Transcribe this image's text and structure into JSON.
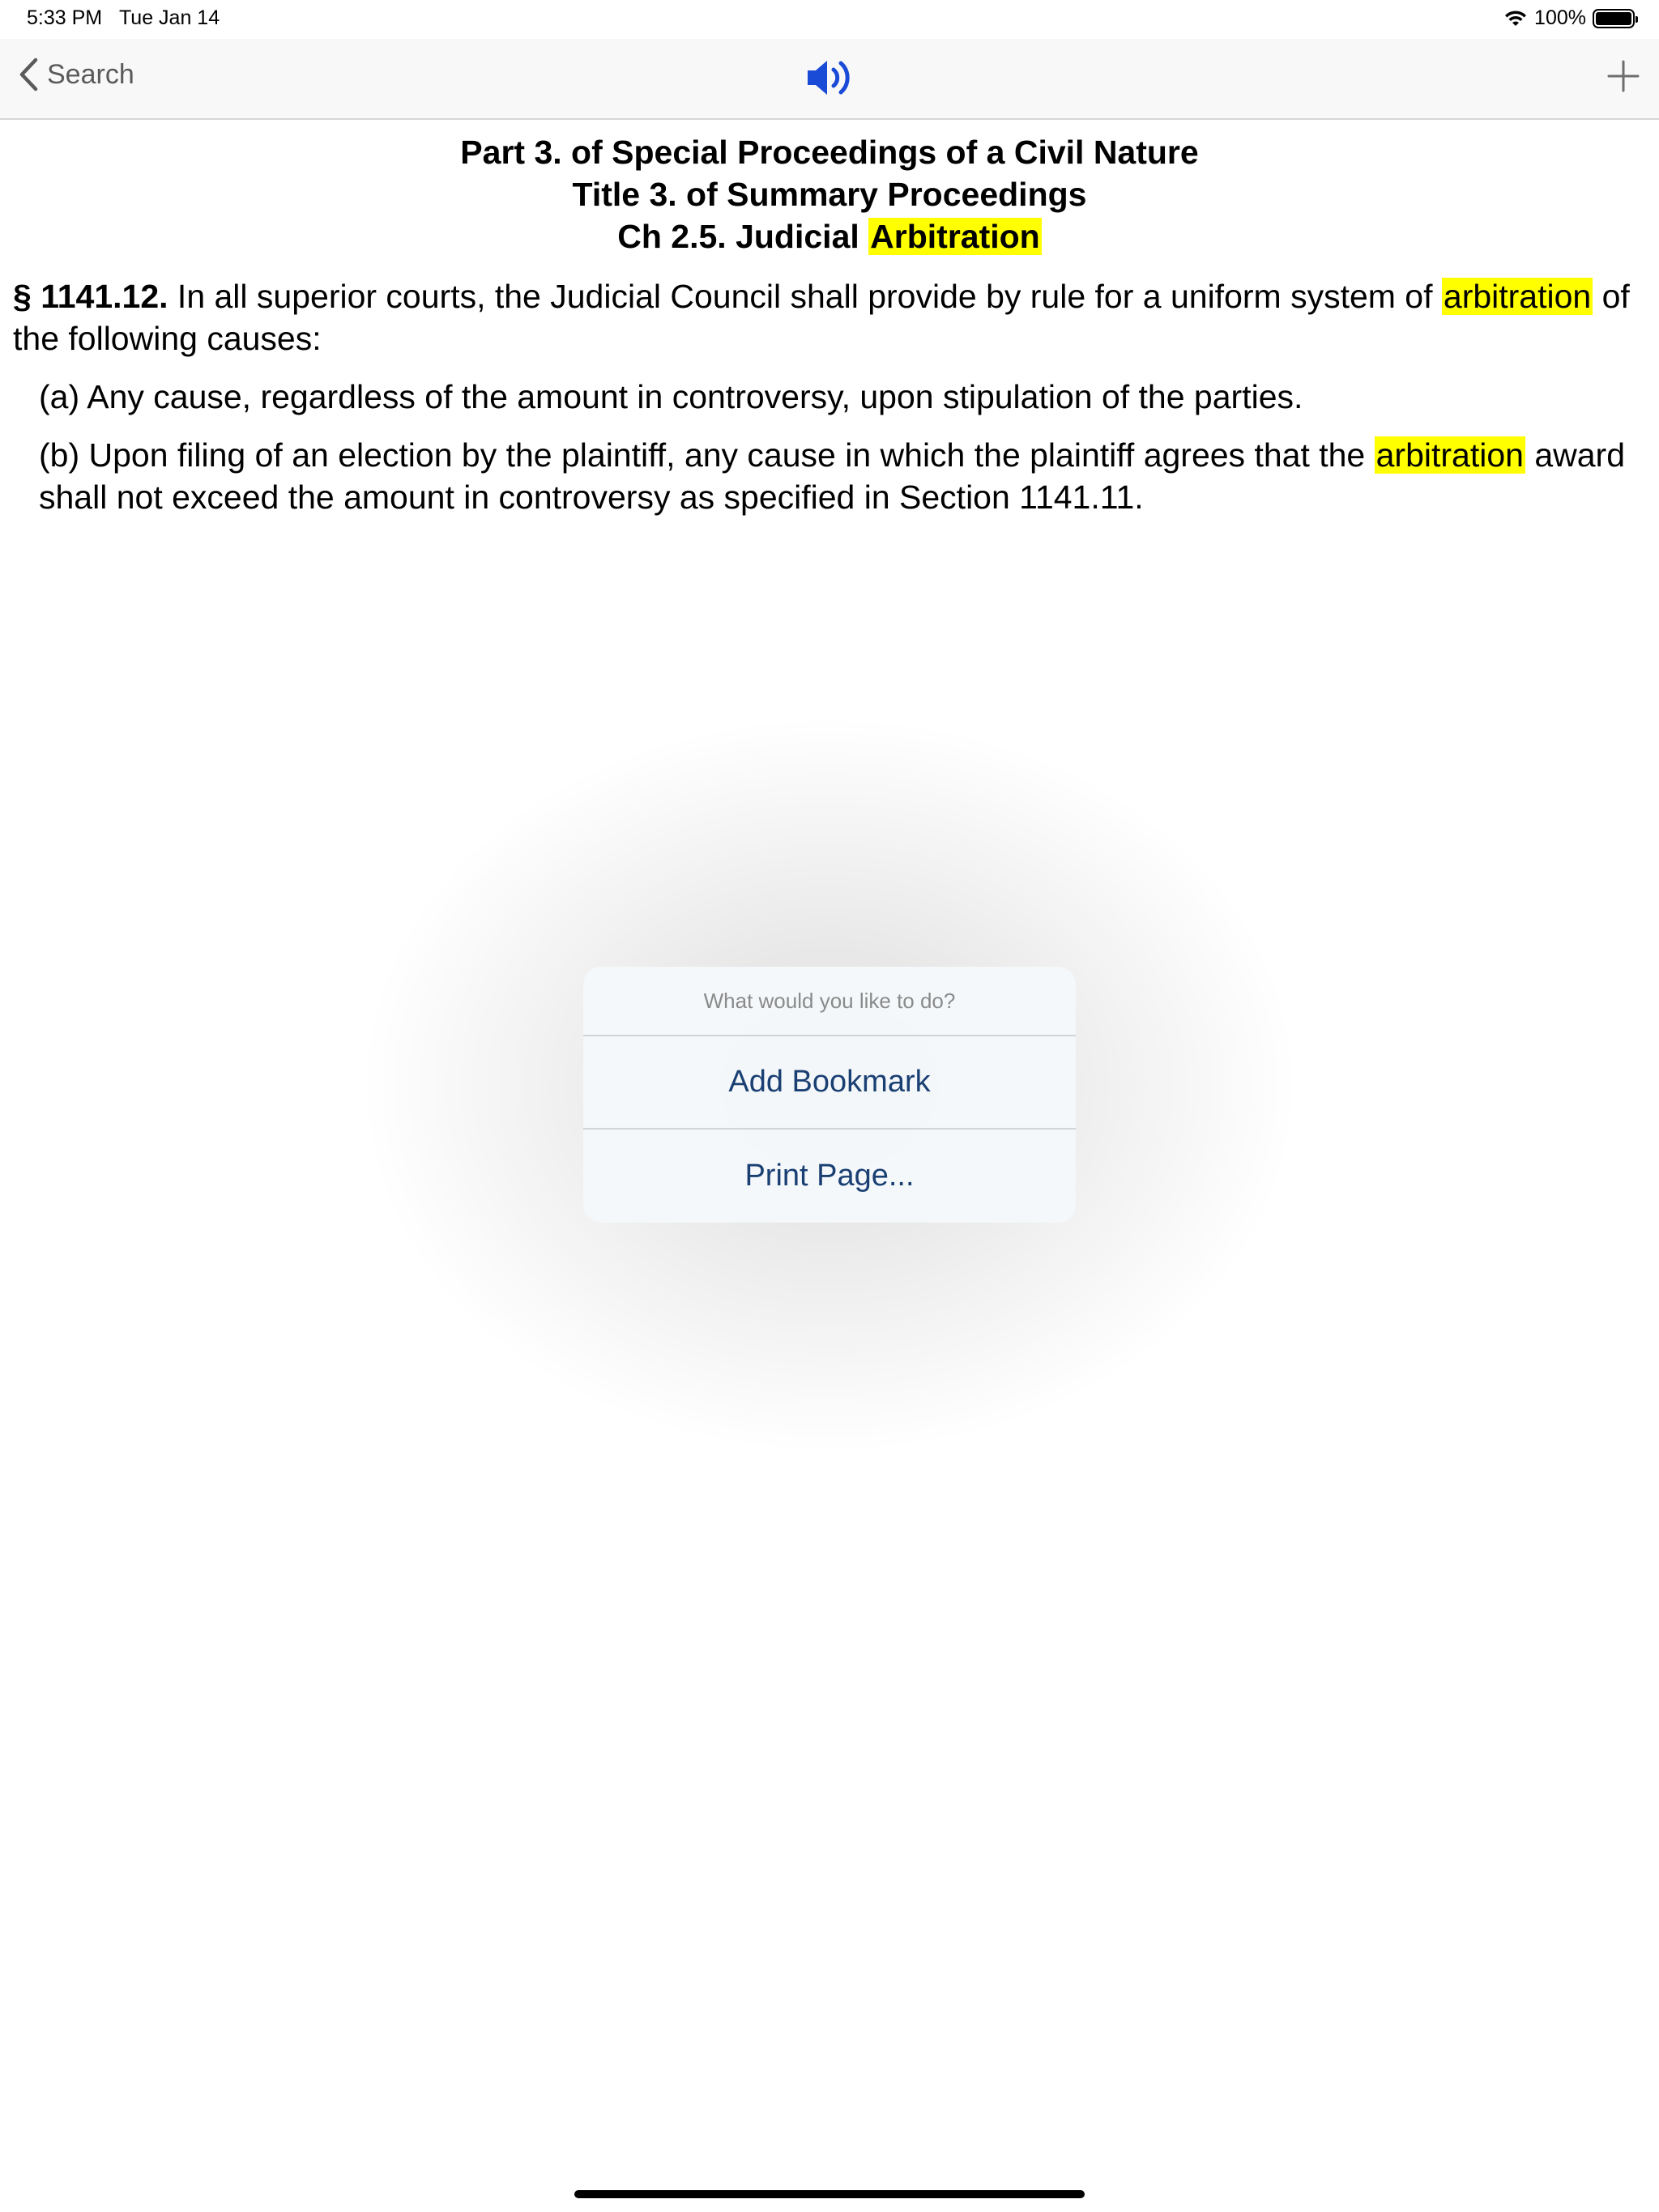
{
  "status_bar": {
    "time": "5:33 PM",
    "date": "Tue Jan 14",
    "battery": "100%",
    "wifi_icon": "wifi-icon",
    "battery_level": 1.0
  },
  "nav": {
    "back_label": "Search",
    "speaker_icon": "speaker-icon",
    "add_icon": "plus-icon"
  },
  "heading": {
    "line1": "Part 3. of Special Proceedings of a Civil Nature",
    "line2": "Title 3. of Summary Proceedings",
    "line3_prefix": "Ch 2.5. Judicial",
    "line3_highlight": "Arbitration"
  },
  "section": {
    "number": "§ 1141.12.",
    "text_before": " In all superior courts, the Judicial Council shall provide by rule for a uniform system of ",
    "highlight": "arbitration",
    "text_after": " of the following causes:",
    "item_a": "(a) Any cause, regardless of the amount in controversy, upon stipulation of the parties.",
    "item_b_before": "(b) Upon filing of an election by the plaintiff, any cause in which the plaintiff agrees that the ",
    "item_b_highlight": "arbitration",
    "item_b_after": " award shall not exceed the amount in controversy as specified in Section 1141.11."
  },
  "action_sheet": {
    "title": "What would you like to do?",
    "add_bookmark": "Add Bookmark",
    "print_page": "Print Page..."
  },
  "colors": {
    "highlight": "#ffff00",
    "action_text": "#1a3f73",
    "speaker": "#1a4bd6"
  }
}
